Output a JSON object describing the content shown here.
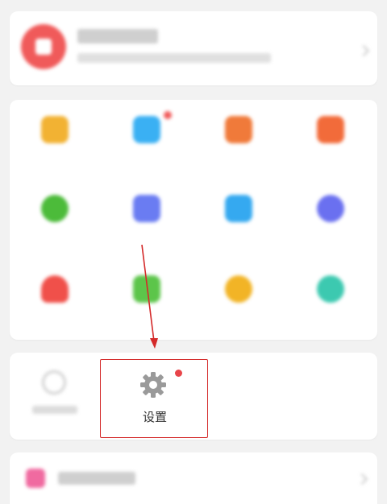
{
  "header_card": {
    "title": "",
    "subtitle": "",
    "icon": "app-badge-icon",
    "icon_color": "#f05a5a"
  },
  "grid_items": [
    {
      "icon": "grid-icon-1",
      "color": "#f2b233",
      "label": ""
    },
    {
      "icon": "grid-icon-2",
      "color": "#3ab0f3",
      "label": "",
      "badge": true
    },
    {
      "icon": "grid-icon-3",
      "color": "#f07a3a",
      "label": ""
    },
    {
      "icon": "grid-icon-4",
      "color": "#f26b3a",
      "label": ""
    },
    {
      "icon": "grid-icon-5",
      "color": "#4cbb3a",
      "label": ""
    },
    {
      "icon": "grid-icon-6",
      "color": "#6a7cf2",
      "label": ""
    },
    {
      "icon": "grid-icon-7",
      "color": "#35a9f0",
      "label": ""
    },
    {
      "icon": "grid-icon-8",
      "color": "#6a70f0",
      "label": ""
    },
    {
      "icon": "grid-icon-9",
      "color": "#f0504a",
      "label": ""
    },
    {
      "icon": "grid-icon-10",
      "color": "#5cc54a",
      "label": ""
    },
    {
      "icon": "grid-icon-11",
      "color": "#f2b426",
      "label": ""
    },
    {
      "icon": "grid-icon-12",
      "color": "#3cc9b0",
      "label": ""
    }
  ],
  "bottom_row": {
    "first_item_label": "",
    "settings_label": "设置",
    "settings_icon": "gear-icon",
    "badge_color": "#e8454a",
    "highlight_color": "#d42a2a"
  },
  "footer_card": {
    "label": "",
    "icon": "footer-pink-icon",
    "icon_color": "#f06aa0"
  }
}
